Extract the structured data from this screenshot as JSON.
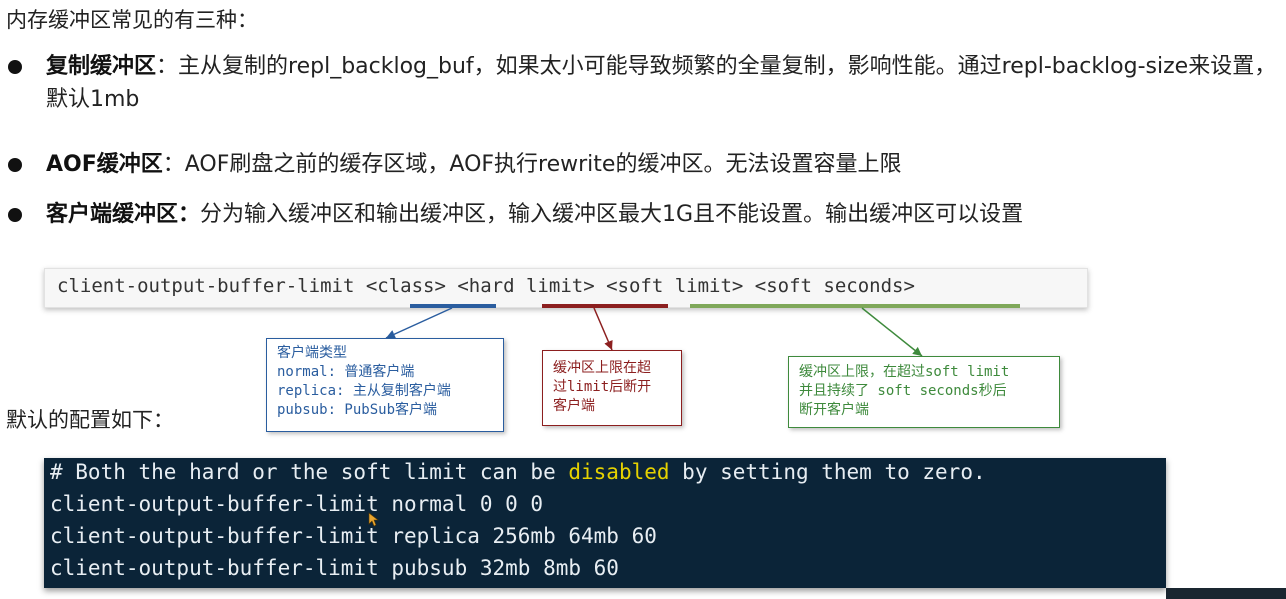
{
  "title": "内存缓冲区常见的有三种：",
  "bullets": [
    {
      "label": "复制缓冲区",
      "text": "：主从复制的repl_backlog_buf，如果太小可能导致频繁的全量复制，影响性能。通过repl-backlog-size来设置，默认1mb"
    },
    {
      "label": "AOF缓冲区",
      "text": "：AOF刷盘之前的缓存区域，AOF执行rewrite的缓冲区。无法设置容量上限"
    },
    {
      "label": "客户端缓冲区：",
      "text": "分为输入缓冲区和输出缓冲区，输入缓冲区最大1G且不能设置。输出缓冲区可以设置"
    }
  ],
  "command": "client-output-buffer-limit <class> <hard limit> <soft limit> <soft seconds>",
  "callouts": {
    "class": {
      "title": "客户端类型",
      "lines": [
        "normal: 普通客户端",
        "replica: 主从复制客户端",
        "pubsub: PubSub客户端"
      ],
      "color": "#2a5d9f"
    },
    "hard": {
      "lines": [
        "缓冲区上限在超",
        "过limit后断开",
        "客户端"
      ],
      "color": "#8c1f1f"
    },
    "soft": {
      "lines": [
        "缓冲区上限，在超过soft limit",
        "并且持续了 soft seconds秒后",
        "断开客户端"
      ],
      "color": "#3e8a3c"
    }
  },
  "config_label": "默认的配置如下：",
  "terminal": {
    "comment_before": "# Both the hard or the soft limit can be ",
    "comment_highlight": "disabled",
    "comment_after": " by setting them to zero.",
    "lines": [
      "client-output-buffer-limit normal 0 0 0",
      "client-output-buffer-limit replica 256mb 64mb 60",
      "client-output-buffer-limit pubsub 32mb 8mb 60"
    ],
    "bg": "#0b2438",
    "highlight_color": "#e6d200"
  }
}
